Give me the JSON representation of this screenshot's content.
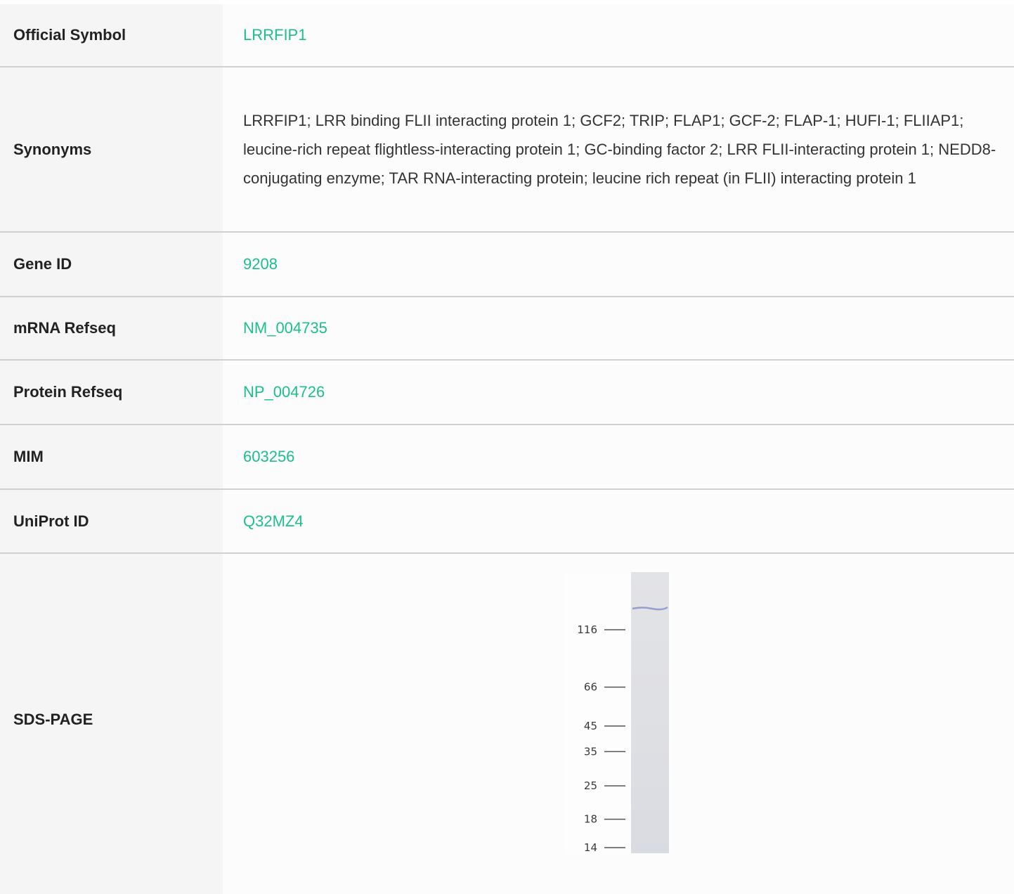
{
  "rows": {
    "official_symbol": {
      "label": "Official Symbol",
      "value": "LRRFIP1"
    },
    "synonyms": {
      "label": "Synonyms",
      "value": "LRRFIP1; LRR binding FLII interacting protein 1; GCF2; TRIP; FLAP1; GCF-2; FLAP-1; HUFI-1; FLIIAP1; leucine-rich repeat flightless-interacting protein 1; GC-binding factor 2; LRR FLII-interacting protein 1; NEDD8-conjugating enzyme; TAR RNA-interacting protein; leucine rich repeat (in FLII) interacting protein 1"
    },
    "gene_id": {
      "label": "Gene ID",
      "value": "9208"
    },
    "mrna_refseq": {
      "label": "mRNA Refseq",
      "value": "NM_004735"
    },
    "protein_refseq": {
      "label": "Protein Refseq",
      "value": "NP_004726"
    },
    "mim": {
      "label": "MIM",
      "value": "603256"
    },
    "uniprot_id": {
      "label": "UniProt ID",
      "value": "Q32MZ4"
    },
    "sds_page": {
      "label": "SDS-PAGE"
    }
  },
  "gel": {
    "markers": [
      {
        "label": "116",
        "kda": 116
      },
      {
        "label": "66",
        "kda": 66
      },
      {
        "label": "45",
        "kda": 45
      },
      {
        "label": "35",
        "kda": 35
      },
      {
        "label": "25",
        "kda": 25
      },
      {
        "label": "18",
        "kda": 18
      },
      {
        "label": "14",
        "kda": 14
      }
    ]
  },
  "colors": {
    "link": "#1cbf8c",
    "label_bg": "#f5f5f5",
    "border": "#d0d0d0"
  }
}
